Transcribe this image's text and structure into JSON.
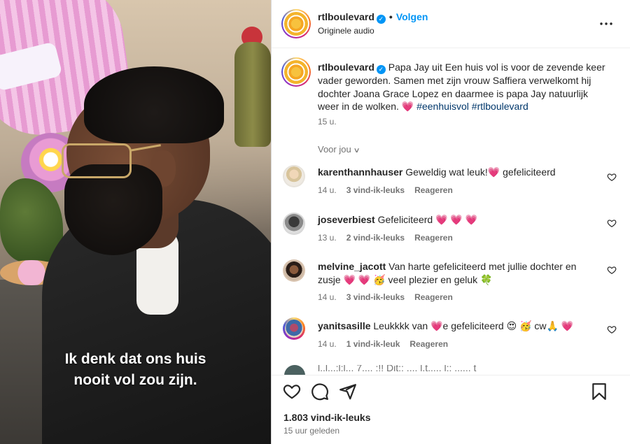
{
  "video": {
    "subtitle_line1": "Ik denk dat ons huis",
    "subtitle_line2": "nooit vol zou zijn."
  },
  "post": {
    "username": "rtlboulevard",
    "verified": true,
    "separator": "•",
    "follow_label": "Volgen",
    "audio_label": "Originele audio",
    "more_icon": "more-options-icon",
    "caption_username": "rtlboulevard",
    "caption_text": "Papa Jay uit Een huis vol is voor de zevende keer vader geworden. Samen met zijn vrouw Saffiera verwelkomt hij dochter Joana Grace Lopez en daarmee is papa Jay natuurlijk weer in de wolken.",
    "caption_emoji": "💗",
    "hashtags": [
      "#eenhuisvol",
      "#rtlboulevard"
    ],
    "caption_time": "15 u."
  },
  "filter": {
    "label": "Voor jou"
  },
  "comments": [
    {
      "username": "karenthannhauser",
      "text": "Geweldig wat leuk!💗 gefeliciteerd",
      "time": "14 u.",
      "likes": "3 vind-ik-leuks",
      "reply": "Reageren"
    },
    {
      "username": "joseverbiest",
      "text": "Gefeliciteerd 💗 💗 💗",
      "time": "13 u.",
      "likes": "2 vind-ik-leuks",
      "reply": "Reageren"
    },
    {
      "username": "melvine_jacott",
      "text": "Van harte gefeliciteerd met jullie dochter en zusje 💗 💗 🥳 veel plezier en geluk 🍀",
      "time": "14 u.",
      "likes": "3 vind-ik-leuks",
      "reply": "Reageren"
    },
    {
      "username": "yanitsasille",
      "text": "Leukkkk van 💗e gefeliciteerd 😍 🥳 cw🙏 💗",
      "time": "14 u.",
      "likes": "1 vind-ik-leuk",
      "reply": "Reageren"
    }
  ],
  "partial_comment": {
    "text": "l..l...:l:l...  7....  :!! Dit:: .... l.t..... l:: ......  t"
  },
  "actions": {
    "like_icon": "heart-icon",
    "comment_icon": "comment-icon",
    "share_icon": "share-icon",
    "save_icon": "bookmark-icon",
    "likes_count": "1.803 vind-ik-leuks",
    "posted_ago": "15 uur geleden"
  },
  "colors": {
    "accent": "#0095f6",
    "heart": "#e0409a",
    "secondary_text": "#737373"
  }
}
